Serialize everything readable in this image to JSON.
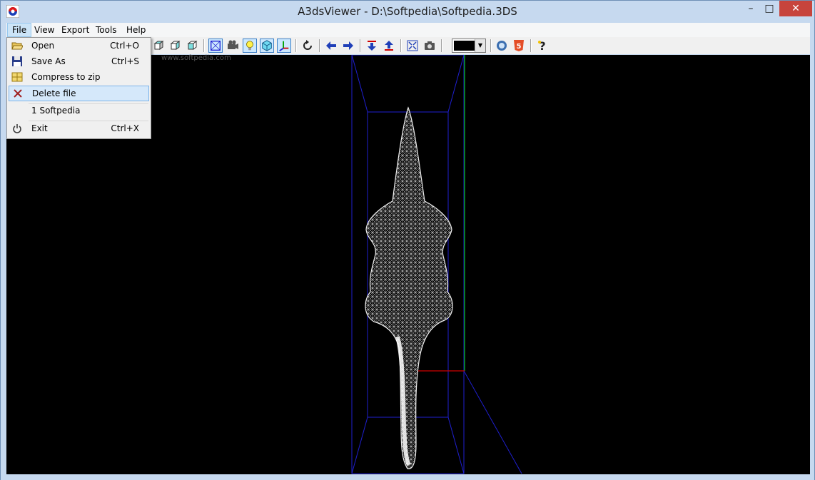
{
  "window": {
    "title": "A3dsViewer - D:\\Softpedia\\Softpedia.3DS",
    "min_label": "–",
    "max_label": "□",
    "close_label": "✕"
  },
  "menubar": {
    "items": [
      {
        "label": "File"
      },
      {
        "label": "View"
      },
      {
        "label": "Export"
      },
      {
        "label": "Tools"
      },
      {
        "label": "Help"
      }
    ]
  },
  "file_menu": {
    "items": [
      {
        "label": "Open",
        "shortcut": "Ctrl+O",
        "icon": "folder-open-icon"
      },
      {
        "label": "Save As",
        "shortcut": "Ctrl+S",
        "icon": "floppy-disk-icon"
      },
      {
        "label": "Compress to zip",
        "shortcut": "",
        "icon": "zip-archive-icon"
      },
      {
        "label": "Delete file",
        "shortcut": "",
        "icon": "delete-x-icon"
      },
      {
        "label": "1 Softpedia",
        "shortcut": "",
        "icon": ""
      },
      {
        "label": "Exit",
        "shortcut": "Ctrl+X",
        "icon": "power-icon"
      }
    ]
  },
  "watermark": "www.softpedia.com",
  "toolbar": {
    "color_value": "#000000",
    "icons": [
      "cube-front-icon",
      "cube-side-icon",
      "cube-top-icon",
      "bounding-box-icon",
      "camera-film-icon",
      "light-bulb-icon",
      "cube-solid-icon",
      "axes-icon",
      "rotate-icon",
      "arrow-left-icon",
      "arrow-right-icon",
      "arrow-down-icon",
      "arrow-up-icon",
      "fit-screen-icon",
      "screenshot-camera-icon",
      "color-picker",
      "pdf-3d-icon",
      "html5-icon",
      "help-icon"
    ]
  },
  "colors": {
    "accent": "#3d7fc6",
    "viewport_bg": "#000000",
    "bbox_line": "#1f1fd0",
    "mesh": "#e8e8e8",
    "axis_green": "#00c000",
    "axis_red": "#d00000"
  }
}
